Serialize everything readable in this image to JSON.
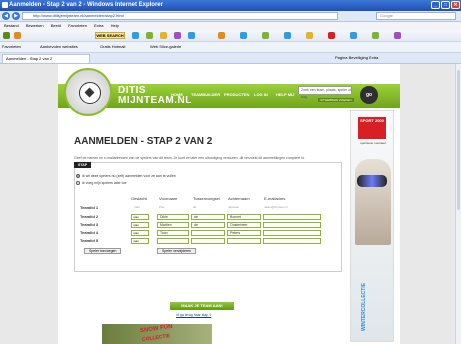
{
  "window": {
    "title": "Aanmelden - Stap 2 van 2 - Windows Internet Explorer"
  },
  "browser": {
    "url": "http://www.ditisjemijnteam.nl/aanmelden/stap2.html",
    "search_placeholder": "Google",
    "menu": [
      "Bestand",
      "Bewerken",
      "Beeld",
      "Favorieten",
      "Extra",
      "Help"
    ],
    "toolbar_search_label": "WEB SEARCH",
    "favorites_label": "Favorieten",
    "fav_links": [
      "Aanbevolen websites",
      "Gratis Hotmail",
      "Web Slice-galerie"
    ],
    "tab_title": "Aanmelden - Stap 2 van 2",
    "command_bar": "Pagina  Beveiliging  Extra"
  },
  "site": {
    "logo_line1": "DITIS",
    "logo_line2": "MIJNTEAM.NL",
    "nav": [
      "HOME",
      "TEAMBUILDER",
      "PRODUCTEN",
      "LOG IN",
      "HELP MIJ"
    ],
    "search_placeholder": "Zoek een team, plaats, speler of bag",
    "search_advanced": "UITGEBREID ZOEKEN",
    "search_go": "go"
  },
  "page": {
    "heading": "AANMELDEN - STAP 2 VAN 2",
    "intro": "Geef de namen en e-mailadressen van de spelers van dit team. Je kunt ze later een uitnodiging versturen, dit verzoekt dit aanmeldingen compleet to.",
    "section_label": "STAP",
    "radio_options": [
      "Ik wil deze spelers nu (zelf) aanmelden voor ze aan te vullen",
      "Ik voeg mijn spelers later toe"
    ],
    "columns": [
      "Geslacht",
      "Voornaam",
      "Tussenvoegsel",
      "Achternaam",
      "E-mailadres"
    ],
    "column_hints": [
      "man",
      "Piet",
      "de",
      "Janssen",
      "naam@domein.nl"
    ],
    "rows": [
      {
        "label": "Teamlid 2",
        "geslacht": "man",
        "voornaam": "Dikie",
        "tussen": "de",
        "achternaam": "Bonnet",
        "email": ""
      },
      {
        "label": "Teamlid 3",
        "geslacht": "man",
        "voornaam": "Martien",
        "tussen": "de",
        "achternaam": "Oosterbeer",
        "email": ""
      },
      {
        "label": "Teamlid 4",
        "geslacht": "man",
        "voornaam": "Toon",
        "tussen": "",
        "achternaam": "Peters",
        "email": ""
      },
      {
        "label": "Teamlid 5",
        "geslacht": "man",
        "voornaam": "",
        "tussen": "",
        "achternaam": "",
        "email": ""
      }
    ],
    "first_row_label": "Teamlid 1",
    "btn_add": "Speler toevoegen",
    "btn_remove": "Speler verwijderen",
    "submit": "MAAK JE TEAM AAN!",
    "back_link": "of ga terug naar stap 1"
  },
  "ads": {
    "sport_brand": "SPORT 2000",
    "sport_sub": "sportiever voordeel",
    "winter": "WINTERCOLLECTIE",
    "bottom_line1": "SNOW FUN",
    "bottom_line2": "COLLECTIE"
  }
}
